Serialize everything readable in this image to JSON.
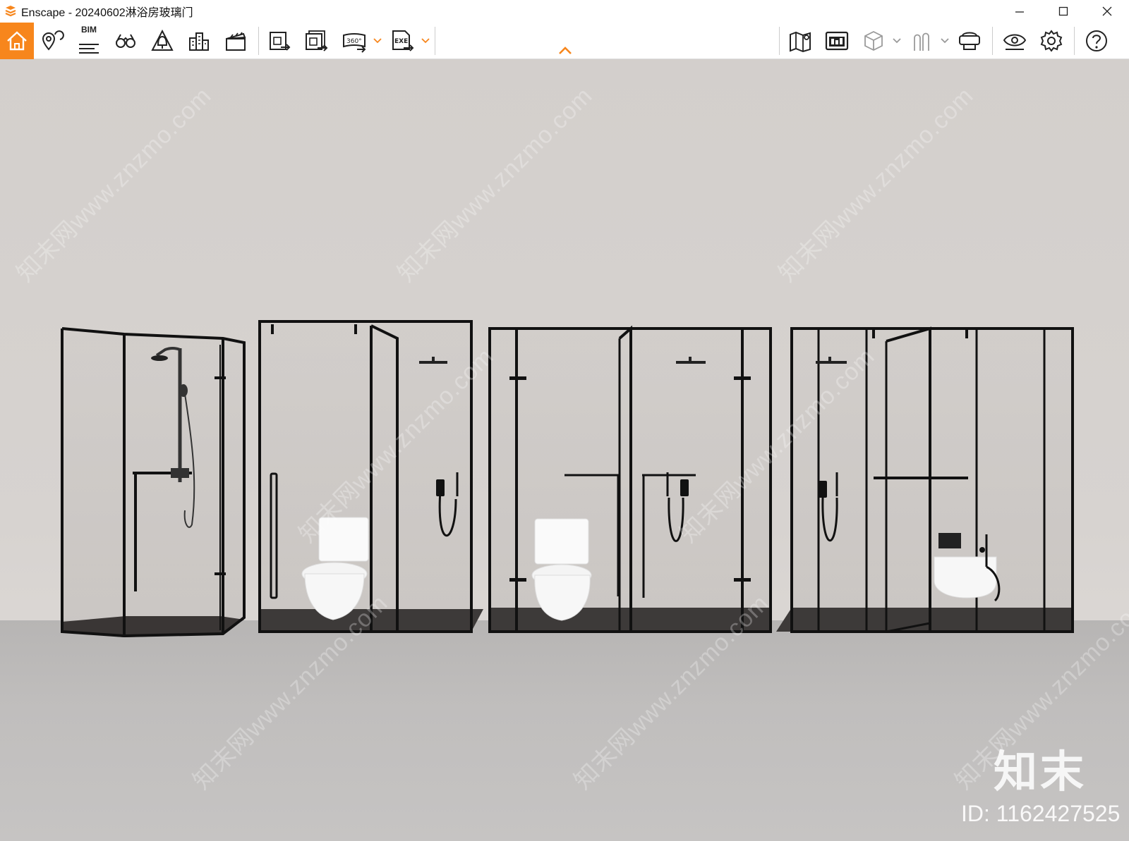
{
  "window": {
    "title": "Enscape - 20240602淋浴房玻璃门",
    "minimize": "—",
    "maximize": "☐",
    "close": "✕"
  },
  "toolbar": {
    "bim_label": "BIM",
    "left_buttons": [
      {
        "icon": "home-icon"
      },
      {
        "icon": "location-pin-icon"
      },
      {
        "icon": "bim-icon"
      },
      {
        "icon": "binoculars-icon"
      },
      {
        "icon": "bell-tree-icon"
      },
      {
        "icon": "buildings-icon"
      },
      {
        "icon": "clapperboard-icon"
      },
      {
        "icon": "export-image-icon"
      },
      {
        "icon": "batch-export-icon"
      },
      {
        "icon": "panorama-360-icon"
      },
      {
        "icon": "export-exe-icon"
      }
    ],
    "right_buttons": [
      {
        "icon": "map-icon"
      },
      {
        "icon": "asset-library-icon"
      },
      {
        "icon": "cube-icon"
      },
      {
        "icon": "people-icon"
      },
      {
        "icon": "vr-headset-icon"
      },
      {
        "icon": "eye-icon"
      },
      {
        "icon": "gear-icon"
      },
      {
        "icon": "help-icon"
      }
    ],
    "label_360": "360°",
    "label_exe": "EXE"
  },
  "viewport": {
    "watermark_text": "知末网www.znzmo.com",
    "brand_logo": "知末",
    "brand_id": "ID: 1162427525"
  },
  "colors": {
    "accent": "#f7861c",
    "wall": "#d3cfcc",
    "floor": "#bdbbba",
    "frame": "#111111"
  }
}
